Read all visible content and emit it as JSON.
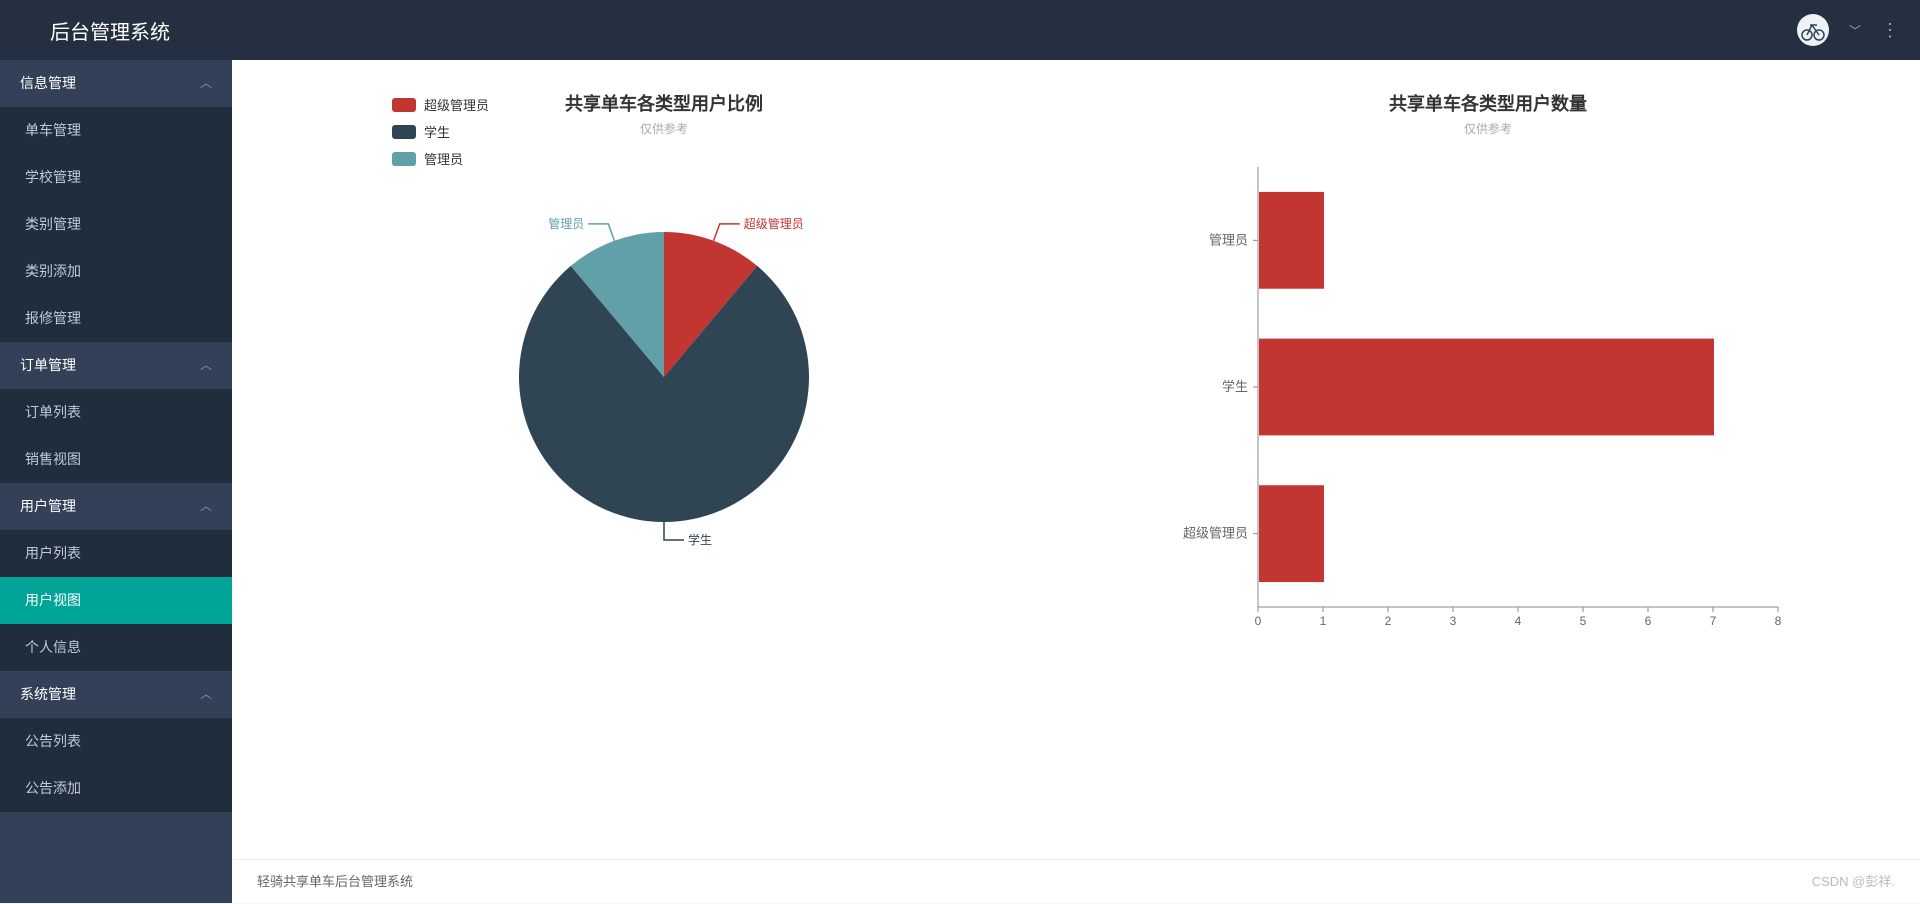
{
  "header": {
    "title": "后台管理系统"
  },
  "sidebar": {
    "groups": [
      {
        "title": "信息管理",
        "items": [
          "单车管理",
          "学校管理",
          "类别管理",
          "类别添加",
          "报修管理"
        ]
      },
      {
        "title": "订单管理",
        "items": [
          "订单列表",
          "销售视图"
        ]
      },
      {
        "title": "用户管理",
        "items": [
          "用户列表",
          "用户视图",
          "个人信息"
        ]
      },
      {
        "title": "系统管理",
        "items": [
          "公告列表",
          "公告添加"
        ]
      }
    ],
    "active": "用户视图"
  },
  "footer": {
    "text": "轻骑共享单车后台管理系统",
    "watermark": "CSDN @彭祥."
  },
  "colors": {
    "red": "#c23531",
    "navy": "#2f4554",
    "teal": "#61a0a8"
  },
  "chart_data": [
    {
      "type": "pie",
      "title": "共享单车各类型用户比例",
      "subtitle": "仅供参考",
      "series": [
        {
          "name": "超级管理员",
          "value": 1,
          "color": "#c23531"
        },
        {
          "name": "学生",
          "value": 7,
          "color": "#2f4554"
        },
        {
          "name": "管理员",
          "value": 1,
          "color": "#61a0a8"
        }
      ]
    },
    {
      "type": "bar",
      "orientation": "horizontal",
      "title": "共享单车各类型用户数量",
      "subtitle": "仅供参考",
      "categories": [
        "管理员",
        "学生",
        "超级管理员"
      ],
      "values": [
        1,
        7,
        1
      ],
      "color": "#c23531",
      "xlim": [
        0,
        8
      ],
      "xticks": [
        0,
        1,
        2,
        3,
        4,
        5,
        6,
        7,
        8
      ]
    }
  ]
}
